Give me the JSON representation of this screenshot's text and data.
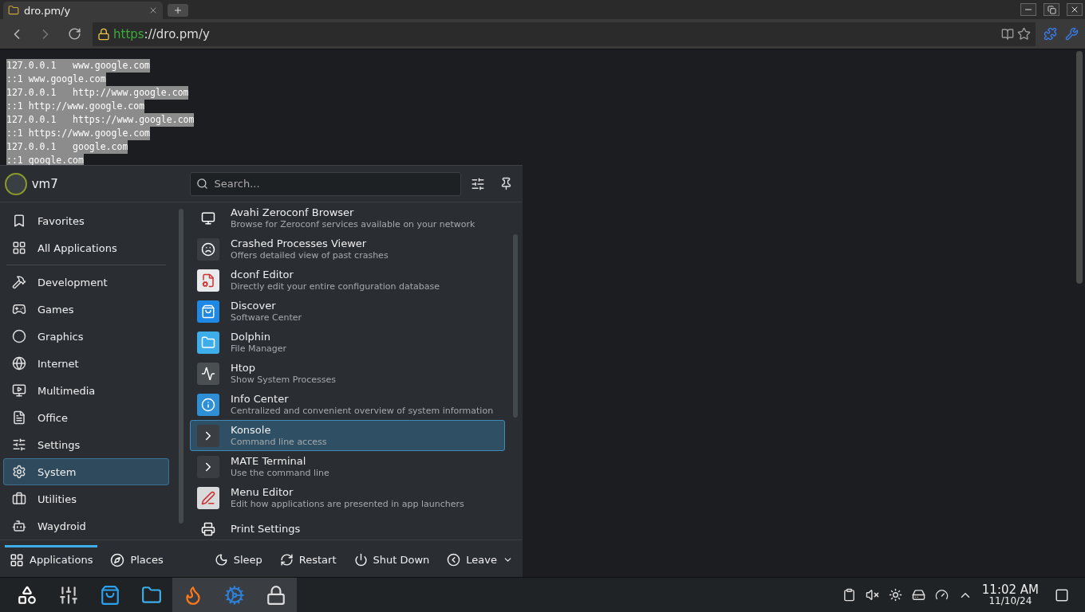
{
  "browser": {
    "tabs": [
      {
        "title": "dro.pm/y",
        "selected": true
      }
    ],
    "url": {
      "scheme": "https",
      "rest": "://dro.pm/y"
    },
    "content_lines": [
      "127.0.0.1   www.google.com",
      "::1 www.google.com",
      "127.0.0.1   http://www.google.com",
      "::1 http://www.google.com",
      "127.0.0.1   https://www.google.com",
      "::1 https://www.google.com",
      "127.0.0.1   google.com",
      "::1 google.com"
    ]
  },
  "launcher": {
    "user": "vm7",
    "search": {
      "placeholder": "Search..."
    },
    "categories": [
      {
        "label": "Favorites",
        "selected": false
      },
      {
        "label": "All Applications",
        "selected": false
      },
      {
        "label": "Development",
        "selected": false
      },
      {
        "label": "Games",
        "selected": false
      },
      {
        "label": "Graphics",
        "selected": false
      },
      {
        "label": "Internet",
        "selected": false
      },
      {
        "label": "Multimedia",
        "selected": false
      },
      {
        "label": "Office",
        "selected": false
      },
      {
        "label": "Settings",
        "selected": false
      },
      {
        "label": "System",
        "selected": true
      },
      {
        "label": "Utilities",
        "selected": false
      },
      {
        "label": "Waydroid",
        "selected": false
      }
    ],
    "apps": [
      {
        "name": "Avahi Zeroconf Browser",
        "description": "Browse for Zeroconf services available on your network",
        "selected": false
      },
      {
        "name": "Crashed Processes Viewer",
        "description": "Offers detailed view of past crashes",
        "selected": false
      },
      {
        "name": "dconf Editor",
        "description": "Directly edit your entire configuration database",
        "selected": false
      },
      {
        "name": "Discover",
        "description": "Software Center",
        "selected": false
      },
      {
        "name": "Dolphin",
        "description": "File Manager",
        "selected": false
      },
      {
        "name": "Htop",
        "description": "Show System Processes",
        "selected": false
      },
      {
        "name": "Info Center",
        "description": "Centralized and convenient overview of system information",
        "selected": false
      },
      {
        "name": "Konsole",
        "description": "Command line access",
        "selected": true
      },
      {
        "name": "MATE Terminal",
        "description": "Use the command line",
        "selected": false
      },
      {
        "name": "Menu Editor",
        "description": "Edit how applications are presented in app launchers",
        "selected": false
      },
      {
        "name": "Print Settings",
        "selected": false
      }
    ],
    "views": [
      {
        "label": "Applications",
        "selected": true
      },
      {
        "label": "Places",
        "selected": false
      }
    ],
    "power": [
      "Sleep",
      "Restart",
      "Shut Down",
      "Leave"
    ]
  },
  "taskbar": {
    "items": [
      {
        "active": false
      },
      {
        "active": false
      },
      {
        "active": false
      },
      {
        "active": false
      },
      {
        "active": true
      },
      {
        "active": true
      },
      {
        "active": true
      }
    ],
    "time": "11:02 AM",
    "date": "11/10/24"
  }
}
